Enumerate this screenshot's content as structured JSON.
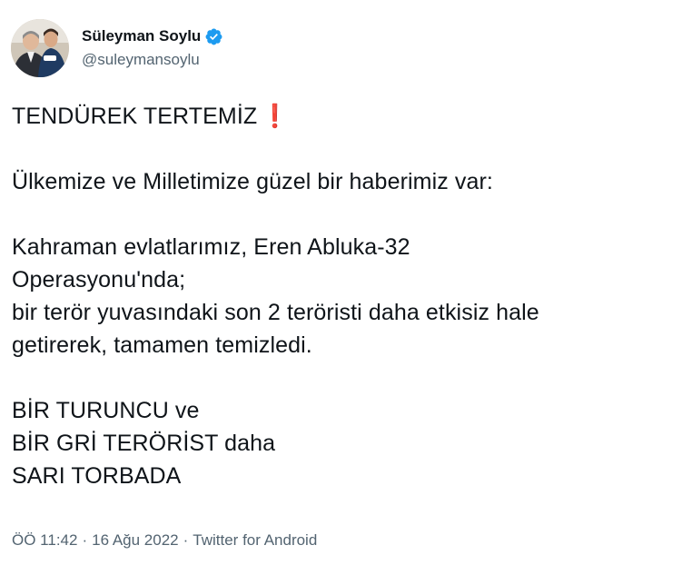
{
  "user": {
    "display_name": "Süleyman Soylu",
    "handle": "@suleymansoylu",
    "verified_icon": "verified-badge-icon",
    "verified_color": "#1d9bf0"
  },
  "tweet": {
    "line1": "TENDÜREK TERTEMİZ",
    "line1_emoji": "❗",
    "paragraph2": "Ülkemize ve Milletimize güzel bir haberimiz var:",
    "paragraph3": "Kahraman evlatlarımız, Eren Abluka-32\nOperasyonu'nda;\nbir terör yuvasındaki son 2 teröristi daha etkisiz hale\ngetirerek, tamamen temizledi.",
    "paragraph4": "BİR TURUNCU ve\nBİR GRİ TERÖRİST daha\nSARI TORBADA"
  },
  "meta": {
    "time": "ÖÖ 11:42",
    "date": "16 Ağu 2022",
    "source": "Twitter for Android",
    "separator": "·"
  },
  "colors": {
    "text": "#0f1419",
    "secondary": "#536471",
    "emoji_red": "#dd2e44"
  }
}
